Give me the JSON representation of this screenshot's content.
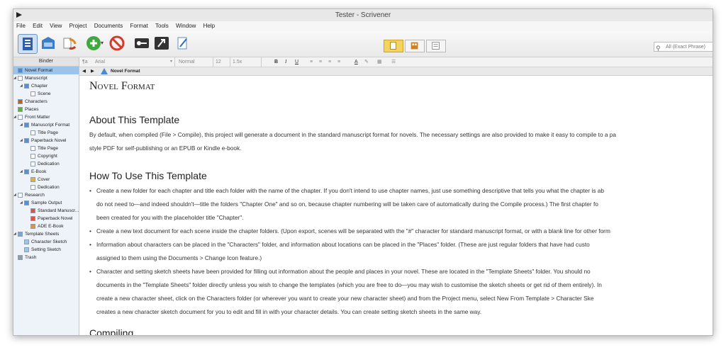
{
  "window": {
    "title": "Tester - Scrivener"
  },
  "menu": [
    "File",
    "Edit",
    "View",
    "Project",
    "Documents",
    "Format",
    "Tools",
    "Window",
    "Help"
  ],
  "search": {
    "placeholder": "All (Exact Phrase)"
  },
  "binder": {
    "header": "Binder",
    "items": [
      {
        "label": "Novel Format",
        "icon": "novel-format-icon",
        "level": 0
      },
      {
        "label": "Manuscript",
        "icon": "manuscript-icon",
        "level": 0
      },
      {
        "label": "Chapter",
        "icon": "folder-icon",
        "level": 1
      },
      {
        "label": "Scene",
        "icon": "document-icon",
        "level": 2
      },
      {
        "label": "Characters",
        "icon": "characters-icon",
        "level": 0
      },
      {
        "label": "Places",
        "icon": "places-icon",
        "level": 0
      },
      {
        "label": "Front Matter",
        "icon": "front-matter-icon",
        "level": 0
      },
      {
        "label": "Manuscript Format",
        "icon": "folder-icon",
        "level": 1
      },
      {
        "label": "Title Page",
        "icon": "document-icon",
        "level": 2
      },
      {
        "label": "Paperback Novel",
        "icon": "folder-icon",
        "level": 1
      },
      {
        "label": "Title Page",
        "icon": "document-icon",
        "level": 2
      },
      {
        "label": "Copyright",
        "icon": "document-icon",
        "level": 2
      },
      {
        "label": "Dedication",
        "icon": "document-icon",
        "level": 2
      },
      {
        "label": "E-Book",
        "icon": "folder-icon",
        "level": 1
      },
      {
        "label": "Cover",
        "icon": "image-icon",
        "level": 2
      },
      {
        "label": "Dedication",
        "icon": "document-icon",
        "level": 2
      },
      {
        "label": "Research",
        "icon": "research-icon",
        "level": 0
      },
      {
        "label": "Sample Output",
        "icon": "folder-icon",
        "level": 1
      },
      {
        "label": "Standard Manuscr...",
        "icon": "pdf-icon",
        "level": 2
      },
      {
        "label": "Paperback Novel",
        "icon": "pdf-icon",
        "level": 2
      },
      {
        "label": "ADE E-Book",
        "icon": "ebook-icon",
        "level": 2
      },
      {
        "label": "Template Sheets",
        "icon": "template-icon",
        "level": 0
      },
      {
        "label": "Character Sketch",
        "icon": "sketch-icon",
        "level": 1
      },
      {
        "label": "Setting Sketch",
        "icon": "sketch-icon",
        "level": 1
      },
      {
        "label": "Trash",
        "icon": "trash-icon",
        "level": 0
      }
    ]
  },
  "formatbar": {
    "style": "¶a",
    "font": "Arial",
    "weight": "Normal",
    "size": "12",
    "spacing": "1.5x",
    "bold": "B",
    "italic": "I",
    "underline": "U"
  },
  "editor_header": {
    "title": "Novel Format"
  },
  "document": {
    "title": "Novel Format",
    "about_heading": "About This Template",
    "about_lines": [
      "By default, when compiled (File > Compile), this project will generate a document in the standard manuscript format for novels. The necessary settings are also provided to make it easy to compile to a pa",
      "style PDF for self-publishing or an EPUB or Kindle e-book."
    ],
    "howto_heading": "How To Use This Template",
    "bullets": [
      [
        "Create a new folder for each chapter and title each folder with the name of the chapter. If you don't intend to use chapter names, just use something descriptive that tells you what the chapter is ab",
        "do not need to—and indeed shouldn't—title the folders \"Chapter One\" and so on, because chapter numbering will be taken care of automatically during the Compile process.) The first chapter fo",
        "been created for you with the placeholder title \"Chapter\"."
      ],
      [
        "Create a new text document for each scene inside the chapter folders. (Upon export, scenes will be separated with the \"#\" character for standard manuscript format, or with a blank line for other form"
      ],
      [
        "Information about characters can be placed in the \"Characters\" folder, and information about locations can be placed in the \"Places\" folder. (These are just regular folders that have had custo",
        "assigned to them using the Documents > Change Icon feature.)"
      ],
      [
        "Character and setting sketch sheets have been provided for filling out information about the people and places in your novel. These are located in the \"Template Sheets\" folder. You should no",
        "documents in the \"Template Sheets\" folder directly unless you wish to change the templates (which you are free to do—you may wish to customise the sketch sheets or get rid of them entirely). In",
        "create a new character sheet, click on the Characters folder (or wherever you want to create your new character sheet) and from the Project menu, select New From Template > Character Ske",
        "creates a new character sketch document for you to edit and fill in with your character details. You can create setting sketch sheets in the same way."
      ]
    ],
    "compiling_heading": "Compiling"
  },
  "colors": {
    "selection": "#9cc3ea",
    "accent": "#f4d35e",
    "binder_bg": "#eef3f9"
  }
}
